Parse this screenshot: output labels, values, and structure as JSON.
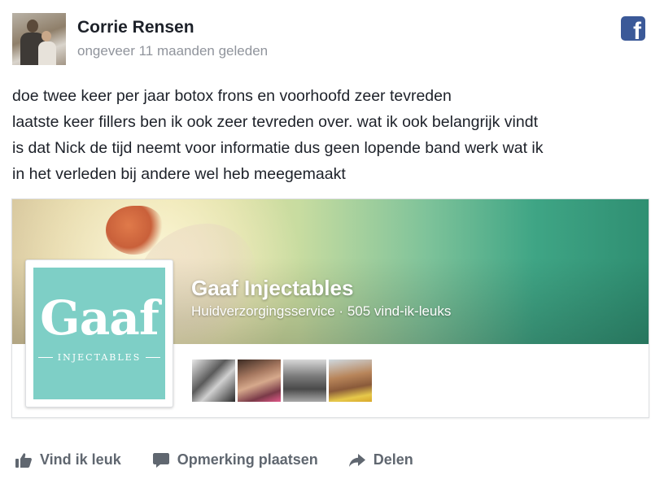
{
  "post": {
    "author": "Corrie Rensen",
    "timestamp": "ongeveer 11 maanden geleden",
    "text_lines": [
      "doe twee keer per jaar botox frons en voorhoofd zeer tevreden",
      "laatste keer fillers ben ik ook zeer tevreden over. wat ik ook belangrijk vindt",
      "is dat Nick de tijd neemt voor informatie dus geen lopende band werk wat ik",
      "in het verleden bij andere wel heb meegemaakt"
    ]
  },
  "page_card": {
    "name": "Gaaf Injectables",
    "category": "Huidverzorgingsservice",
    "separator": "·",
    "likes": "505 vind-ik-leuks",
    "logo": {
      "word": "Gaaf",
      "sub": "INJECTABLES"
    }
  },
  "actions": {
    "like": "Vind ik leuk",
    "comment": "Opmerking plaatsen",
    "share": "Delen"
  },
  "icons": {
    "brand": "facebook-icon",
    "like": "thumbs-up-icon",
    "comment": "speech-bubble-icon",
    "share": "share-arrow-icon"
  },
  "colors": {
    "facebook_blue": "#3b5998",
    "text": "#1d2129",
    "muted": "#90949c",
    "action": "#606770",
    "logo_teal": "#7ecfc6"
  }
}
